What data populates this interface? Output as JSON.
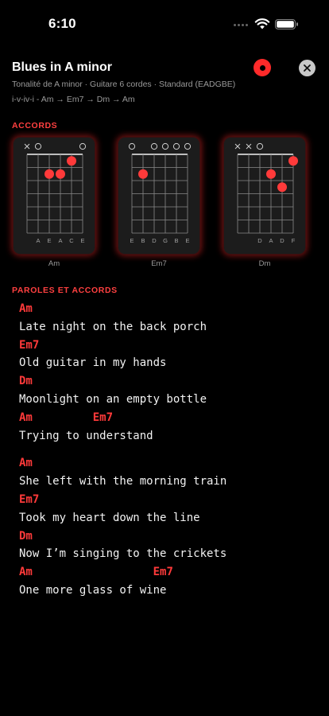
{
  "status_bar": {
    "time": "6:10"
  },
  "header": {
    "title": "Blues in A minor",
    "subtitle": "Tonalité de A minor  ·  Guitare 6 cordes · Standard (EADGBE)",
    "progression": "i-v-iv-i - Am → Em7 → Dm → Am"
  },
  "sections": {
    "chords": "ACCORDS",
    "lyrics": "PAROLES ET ACCORDS"
  },
  "colors": {
    "accent": "#ff3a3a",
    "background": "#000000",
    "card": "#1c1c1c"
  },
  "chords": [
    {
      "name": "Am",
      "open_markers": [
        "x",
        "o",
        "",
        "",
        "",
        "o"
      ],
      "strings": [
        "A",
        "E",
        "A",
        "C",
        "E"
      ],
      "dots": [
        {
          "string": 3,
          "fret": 2
        },
        {
          "string": 4,
          "fret": 2
        },
        {
          "string": 5,
          "fret": 1
        }
      ]
    },
    {
      "name": "Em7",
      "open_markers": [
        "o",
        "",
        "o",
        "o",
        "o",
        "o"
      ],
      "strings": [
        "E",
        "B",
        "D",
        "G",
        "B",
        "E"
      ],
      "dots": [
        {
          "string": 2,
          "fret": 2
        }
      ]
    },
    {
      "name": "Dm",
      "open_markers": [
        "x",
        "x",
        "o",
        "",
        "",
        ""
      ],
      "strings": [
        "D",
        "A",
        "D",
        "F"
      ],
      "dots": [
        {
          "string": 4,
          "fret": 2
        },
        {
          "string": 5,
          "fret": 3
        },
        {
          "string": 6,
          "fret": 1
        }
      ]
    }
  ],
  "lyrics": [
    {
      "chords": [
        {
          "text": "Am",
          "col": 0
        }
      ],
      "text": "Late night on the back porch"
    },
    {
      "chords": [
        {
          "text": "Em7",
          "col": 0
        }
      ],
      "text": "Old guitar in my hands"
    },
    {
      "chords": [
        {
          "text": "Dm",
          "col": 0
        }
      ],
      "text": "Moonlight on an empty bottle"
    },
    {
      "chords": [
        {
          "text": "Am",
          "col": 0
        },
        {
          "text": "Em7",
          "col": 11
        }
      ],
      "text": "Trying to understand"
    },
    {
      "chords": [
        {
          "text": "Am",
          "col": 0
        }
      ],
      "text": "She left with the morning train"
    },
    {
      "chords": [
        {
          "text": "Em7",
          "col": 0
        }
      ],
      "text": "Took my heart down the line"
    },
    {
      "chords": [
        {
          "text": "Dm",
          "col": 0
        }
      ],
      "text": "Now I’m singing to the crickets"
    },
    {
      "chords": [
        {
          "text": "Am",
          "col": 0
        },
        {
          "text": "Em7",
          "col": 20
        }
      ],
      "text": "One more glass of wine"
    }
  ]
}
